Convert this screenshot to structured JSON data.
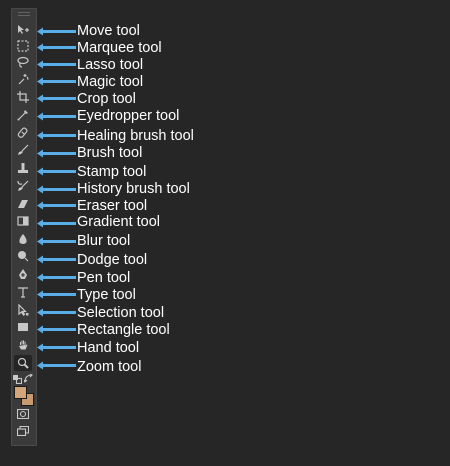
{
  "accent_color": "#5aaee8",
  "tools": [
    {
      "label": "Move tool",
      "icon": "move-icon"
    },
    {
      "label": "Marquee tool",
      "icon": "marquee-icon"
    },
    {
      "label": "Lasso tool",
      "icon": "lasso-icon"
    },
    {
      "label": "Magic tool",
      "icon": "magic-wand-icon"
    },
    {
      "label": "Crop tool",
      "icon": "crop-icon"
    },
    {
      "label": "Eyedropper tool",
      "icon": "eyedropper-icon"
    },
    {
      "label": "Healing brush tool",
      "icon": "healing-brush-icon"
    },
    {
      "label": "Brush tool",
      "icon": "brush-icon"
    },
    {
      "label": "Stamp tool",
      "icon": "stamp-icon"
    },
    {
      "label": "History brush tool",
      "icon": "history-brush-icon"
    },
    {
      "label": "Eraser tool",
      "icon": "eraser-icon"
    },
    {
      "label": "Gradient tool",
      "icon": "gradient-icon"
    },
    {
      "label": "Blur tool",
      "icon": "blur-icon"
    },
    {
      "label": "Dodge tool",
      "icon": "dodge-icon"
    },
    {
      "label": "Pen tool",
      "icon": "pen-icon"
    },
    {
      "label": "Type tool",
      "icon": "type-icon"
    },
    {
      "label": "Selection tool",
      "icon": "path-selection-icon"
    },
    {
      "label": "Rectangle tool",
      "icon": "rectangle-icon"
    },
    {
      "label": "Hand tool",
      "icon": "hand-icon"
    },
    {
      "label": "Zoom tool",
      "icon": "zoom-icon"
    }
  ],
  "foreground_color": "#d2a67a",
  "background_color": "#c89a6e"
}
